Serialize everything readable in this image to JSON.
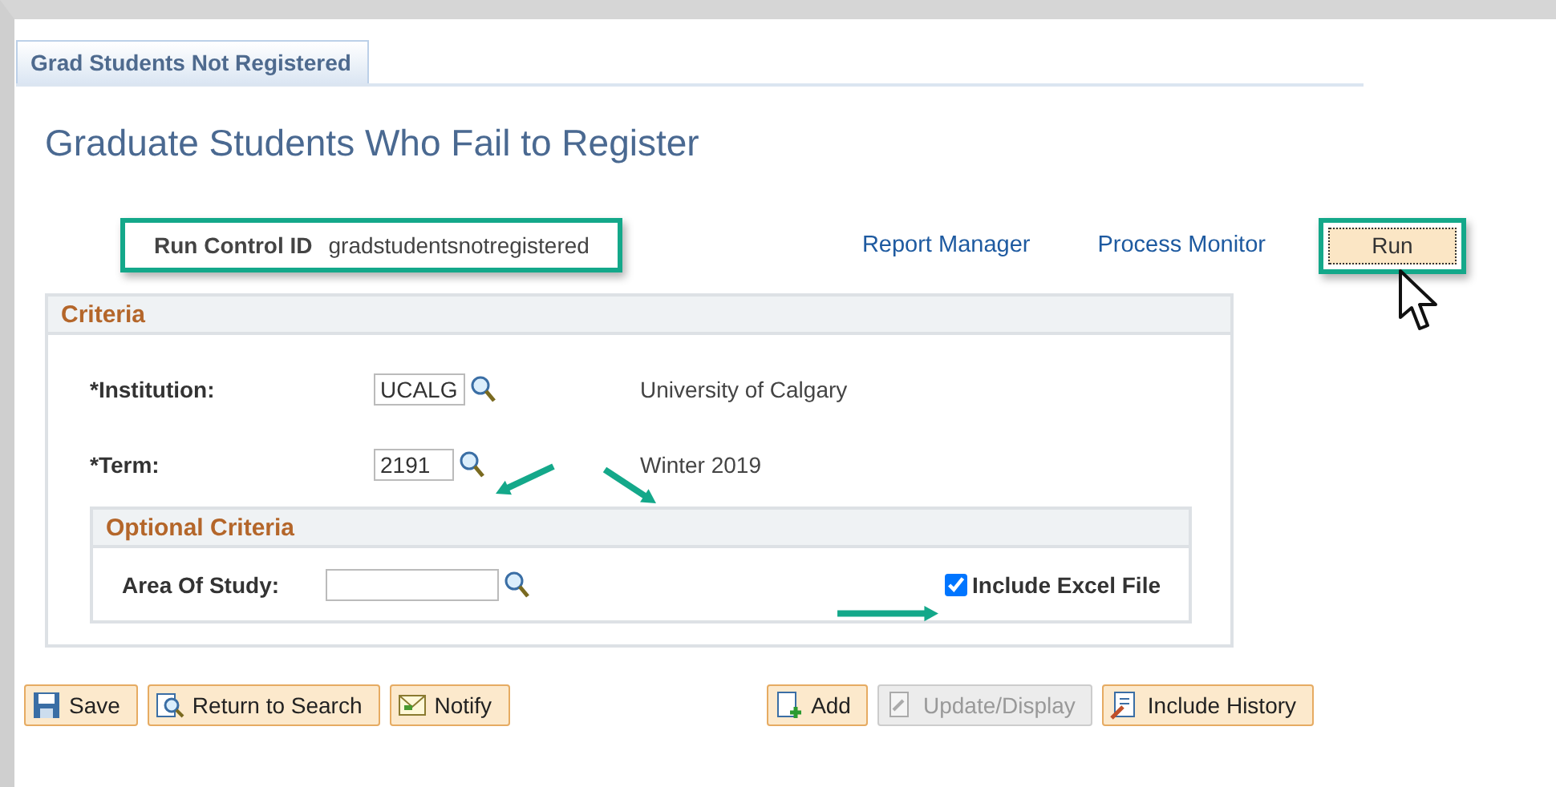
{
  "tab": {
    "label": "Grad Students Not Registered",
    "selected": true
  },
  "title": "Graduate Students Who Fail to Register",
  "run_control": {
    "label": "Run Control ID",
    "value": "gradstudentsnotregistered"
  },
  "links": [
    "Report Manager",
    "Process Monitor"
  ],
  "run_button": "Run",
  "criteria": {
    "title": "Criteria",
    "fields": [
      {
        "label": "*Institution:",
        "value": "UCALG",
        "description": "University of Calgary"
      },
      {
        "label": "*Term:",
        "value": "2191",
        "description": "Winter 2019"
      }
    ]
  },
  "optional": {
    "title": "Optional Criteria",
    "field": {
      "label": "Area Of Study:"
    },
    "checkbox": {
      "label": "Include Excel File",
      "checked": true
    }
  },
  "toolbar": [
    {
      "label": "Save",
      "kind": "save",
      "disabled": false
    },
    {
      "label": "Return to Search",
      "kind": "search",
      "disabled": false
    },
    {
      "label": "Notify",
      "kind": "notify",
      "disabled": false
    },
    {
      "label": "Add",
      "kind": "add",
      "disabled": false
    },
    {
      "label": "Update/Display",
      "kind": "update",
      "disabled": true
    },
    {
      "label": "Include History",
      "kind": "history",
      "disabled": false
    }
  ]
}
